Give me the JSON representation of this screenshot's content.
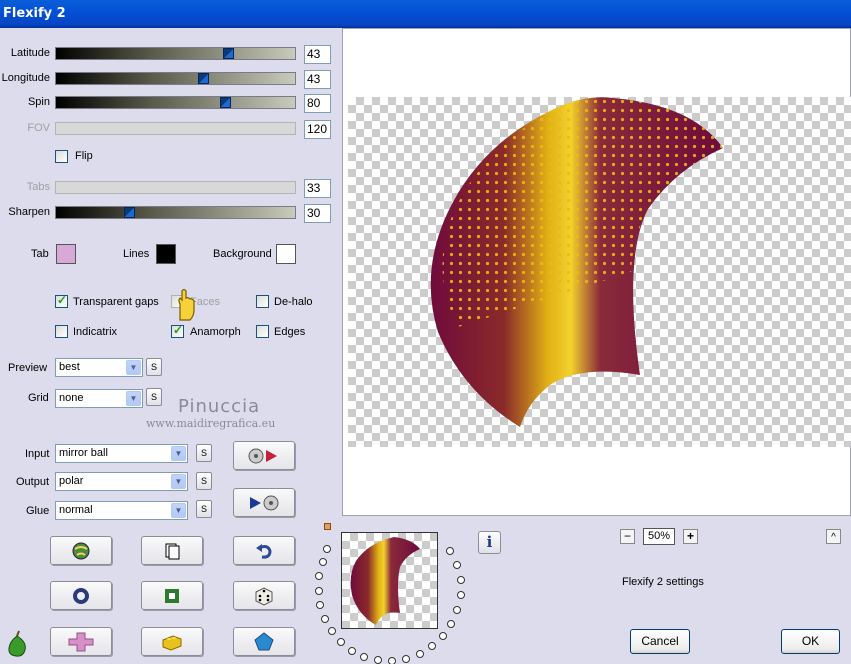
{
  "window": {
    "title": "Flexify 2"
  },
  "sliders": [
    {
      "label": "Latitude",
      "value": "43",
      "disabled": false
    },
    {
      "label": "Longitude",
      "value": "43",
      "disabled": false
    },
    {
      "label": "Spin",
      "value": "80",
      "disabled": false
    },
    {
      "label": "FOV",
      "value": "120",
      "disabled": true
    },
    {
      "label": "Tabs",
      "value": "33",
      "disabled": true
    },
    {
      "label": "Sharpen",
      "value": "30",
      "disabled": false
    }
  ],
  "flip": {
    "label": "Flip",
    "checked": false
  },
  "colors": {
    "tab": {
      "label": "Tab",
      "color": "#d8a8d8"
    },
    "lines": {
      "label": "Lines",
      "color": "#000000"
    },
    "background": {
      "label": "Background",
      "color": "#ffffff"
    }
  },
  "options": {
    "transparent_gaps": {
      "label": "Transparent gaps",
      "checked": true
    },
    "faces": {
      "label": "Faces",
      "checked": false
    },
    "de_halo": {
      "label": "De-halo",
      "checked": false
    },
    "indicatrix": {
      "label": "Indicatrix",
      "checked": false
    },
    "anamorph": {
      "label": "Anamorph",
      "checked": true
    },
    "edges": {
      "label": "Edges",
      "checked": false
    }
  },
  "preview_select": {
    "label": "Preview",
    "value": "best"
  },
  "grid_select": {
    "label": "Grid",
    "value": "none"
  },
  "input_select": {
    "label": "Input",
    "value": "mirror ball"
  },
  "output_select": {
    "label": "Output",
    "value": "polar"
  },
  "glue_select": {
    "label": "Glue",
    "value": "normal"
  },
  "s_label": "S",
  "watermark": {
    "line1": "Pinuccia",
    "line2": "www.maidiregrafica.eu"
  },
  "zoom": {
    "value": "50%",
    "minus": "−",
    "plus": "+"
  },
  "settings_label": "Flexify 2 settings",
  "buttons": {
    "cancel": "Cancel",
    "ok": "OK",
    "up": "^",
    "info": "i"
  }
}
